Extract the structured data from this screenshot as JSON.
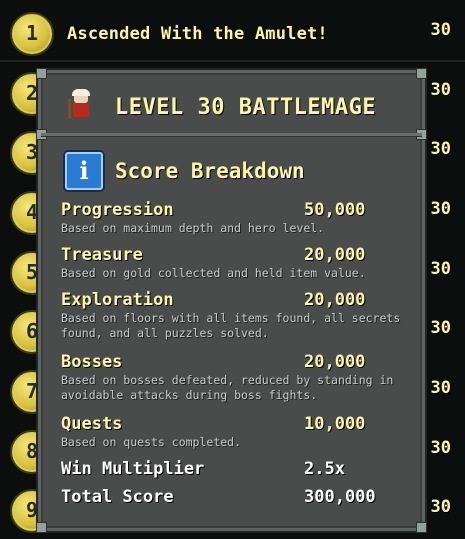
{
  "rankings": [
    {
      "rank": "1",
      "title": "Ascended With the Amulet!",
      "level": "30"
    },
    {
      "rank": "2",
      "level": "30"
    },
    {
      "rank": "3",
      "level": "30"
    },
    {
      "rank": "4",
      "level": "30"
    },
    {
      "rank": "5",
      "level": "30"
    },
    {
      "rank": "6",
      "level": "30"
    },
    {
      "rank": "7",
      "level": "30"
    },
    {
      "rank": "8",
      "level": "30"
    },
    {
      "rank": "9",
      "level": "30"
    }
  ],
  "window": {
    "hero_title": "LEVEL 30 BATTLEMAGE",
    "section_title": "Score Breakdown",
    "info_icon_glyph": "i",
    "entries": [
      {
        "label": "Progression",
        "value": "50,000",
        "desc": "Based on maximum depth and hero level."
      },
      {
        "label": "Treasure",
        "value": "20,000",
        "desc": "Based on gold collected and held item value."
      },
      {
        "label": "Exploration",
        "value": "20,000",
        "desc": "Based on floors with all items found, all secrets found, and all puzzles solved."
      },
      {
        "label": "Bosses",
        "value": "20,000",
        "desc": "Based on bosses defeated, reduced by standing in avoidable attacks during boss fights."
      },
      {
        "label": "Quests",
        "value": "10,000",
        "desc": "Based on quests completed."
      }
    ],
    "multiplier": {
      "label": "Win Multiplier",
      "value": "2.5x"
    },
    "total": {
      "label": "Total Score",
      "value": "300,000"
    }
  },
  "colors": {
    "accent": "#fbf6a8",
    "window_bg": "#4a4c4b",
    "info_blue": "#2c7bd3"
  }
}
